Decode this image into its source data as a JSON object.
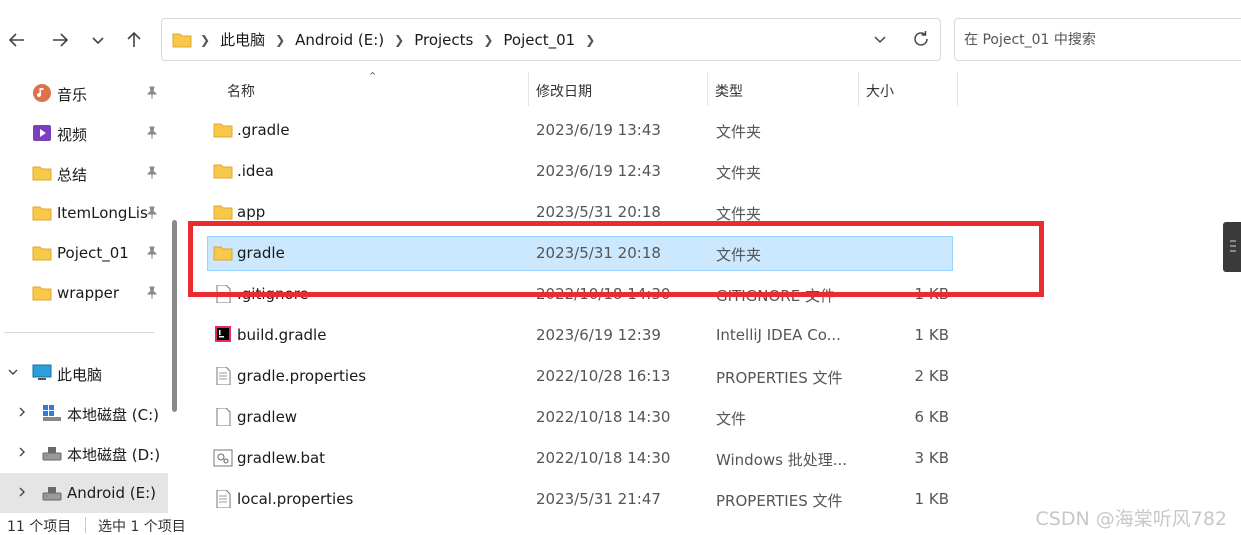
{
  "address_bar": {
    "crumbs": [
      "此电脑",
      "Android (E:)",
      "Projects",
      "Poject_01"
    ]
  },
  "search": {
    "placeholder": "在 Poject_01 中搜索"
  },
  "sidebar": {
    "quick_access": [
      {
        "label": "音乐",
        "icon": "music-icon",
        "pinned": true
      },
      {
        "label": "视频",
        "icon": "video-icon",
        "pinned": true
      },
      {
        "label": "总结",
        "icon": "folder-icon",
        "pinned": true
      },
      {
        "label": "ItemLongLis",
        "icon": "folder-icon",
        "pinned": true
      },
      {
        "label": "Poject_01",
        "icon": "folder-icon",
        "pinned": true
      },
      {
        "label": "wrapper",
        "icon": "folder-icon",
        "pinned": true
      }
    ],
    "this_pc": {
      "label": "此电脑",
      "icon": "computer-icon"
    },
    "drives": [
      {
        "label": "本地磁盘 (C:)",
        "icon": "windows-drive-icon"
      },
      {
        "label": "本地磁盘 (D:)",
        "icon": "drive-icon"
      },
      {
        "label": "Android (E:)",
        "icon": "drive-icon",
        "selected": true
      }
    ]
  },
  "columns": {
    "name": "名称",
    "date": "修改日期",
    "type": "类型",
    "size": "大小"
  },
  "files": [
    {
      "name": ".gradle",
      "date": "2023/6/19 13:43",
      "type": "文件夹",
      "size": "",
      "icon": "folder-icon"
    },
    {
      "name": ".idea",
      "date": "2023/6/19 12:43",
      "type": "文件夹",
      "size": "",
      "icon": "folder-icon"
    },
    {
      "name": "app",
      "date": "2023/5/31 20:18",
      "type": "文件夹",
      "size": "",
      "icon": "folder-icon"
    },
    {
      "name": "gradle",
      "date": "2023/5/31 20:18",
      "type": "文件夹",
      "size": "",
      "icon": "folder-icon",
      "selected": true
    },
    {
      "name": ".gitignore",
      "date": "2022/10/18 14:30",
      "type": "GITIGNORE 文件",
      "size": "1 KB",
      "icon": "file-icon"
    },
    {
      "name": "build.gradle",
      "date": "2023/6/19 12:39",
      "type": "IntelliJ IDEA Co...",
      "size": "1 KB",
      "icon": "intellij-icon"
    },
    {
      "name": "gradle.properties",
      "date": "2022/10/28 16:13",
      "type": "PROPERTIES 文件",
      "size": "2 KB",
      "icon": "text-file-icon"
    },
    {
      "name": "gradlew",
      "date": "2022/10/18 14:30",
      "type": "文件",
      "size": "6 KB",
      "icon": "file-icon"
    },
    {
      "name": "gradlew.bat",
      "date": "2022/10/18 14:30",
      "type": "Windows 批处理...",
      "size": "3 KB",
      "icon": "batch-file-icon"
    },
    {
      "name": "local.properties",
      "date": "2023/5/31 21:47",
      "type": "PROPERTIES 文件",
      "size": "1 KB",
      "icon": "text-file-icon"
    }
  ],
  "status": {
    "count": "11 个项目",
    "selection": "选中 1 个项目"
  },
  "watermark": "CSDN @海棠听风782",
  "colors": {
    "selection": "#cce8ff",
    "highlight_box": "#ec2a32",
    "folder": "#f8c84a"
  }
}
